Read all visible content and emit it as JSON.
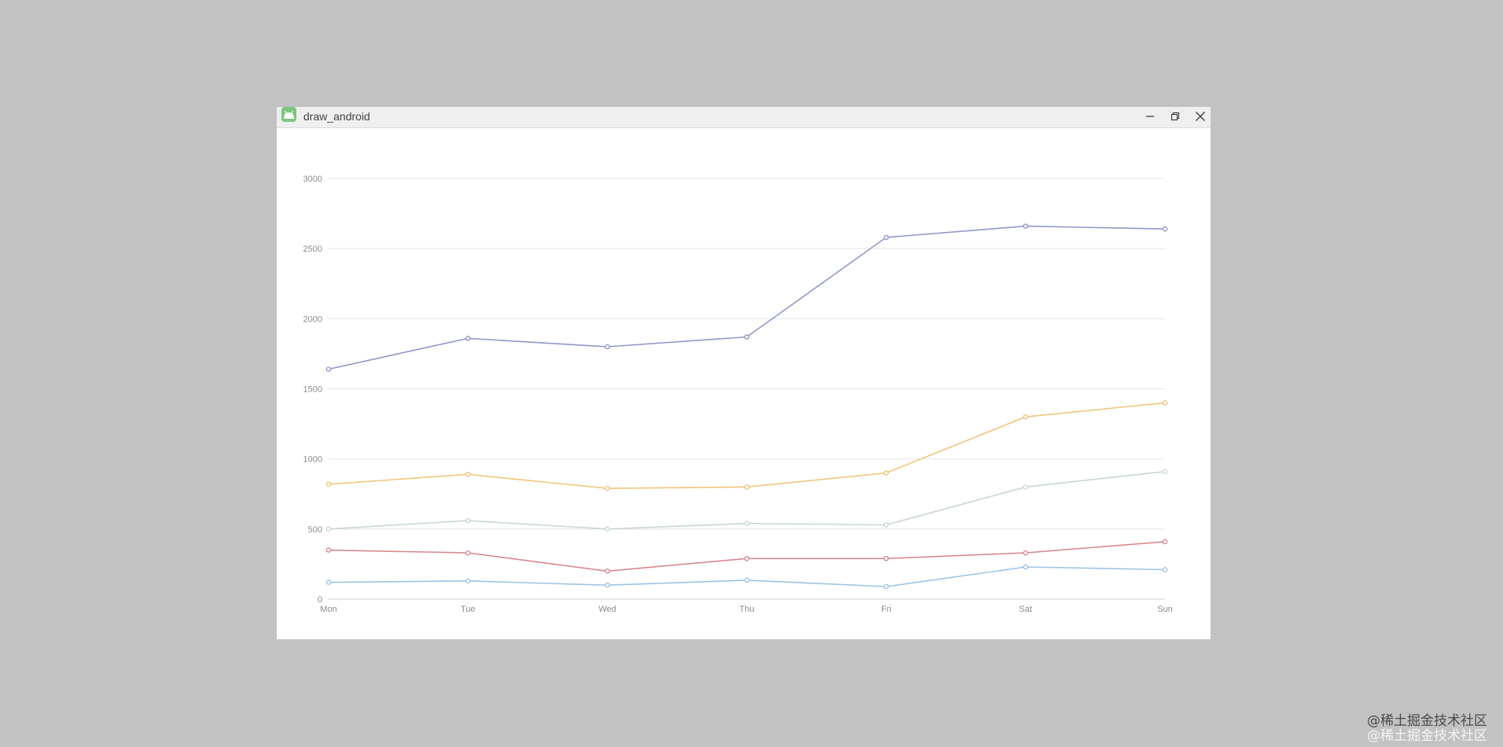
{
  "window": {
    "title": "draw_android",
    "icon": "android-app-icon"
  },
  "controls": {
    "minimize_icon": "minimize-icon",
    "restore_icon": "restore-icon",
    "close_icon": "close-icon"
  },
  "chart_data": {
    "type": "line",
    "categories": [
      "Mon",
      "Tue",
      "Wed",
      "Thu",
      "Fri",
      "Sat",
      "Sun"
    ],
    "ylim": [
      0,
      3000
    ],
    "yticks": [
      0,
      500,
      1000,
      1500,
      2000,
      2500,
      3000
    ],
    "grid": true,
    "series": [
      {
        "color": "#9098c8",
        "values": [
          1640,
          1860,
          1800,
          1870,
          2580,
          2660,
          2640
        ]
      },
      {
        "color": "#f0c47c",
        "values": [
          820,
          890,
          790,
          800,
          900,
          1300,
          1400
        ]
      },
      {
        "color": "#c8d6d8",
        "values": [
          500,
          560,
          500,
          540,
          530,
          800,
          910
        ]
      },
      {
        "color": "#d88890",
        "values": [
          350,
          330,
          200,
          290,
          290,
          330,
          410
        ]
      },
      {
        "color": "#9cc4e4",
        "values": [
          120,
          130,
          100,
          135,
          90,
          230,
          210
        ]
      }
    ]
  },
  "watermark": {
    "line1": "@稀土掘金技术社区",
    "line2": "@稀土掘金技术社区"
  }
}
